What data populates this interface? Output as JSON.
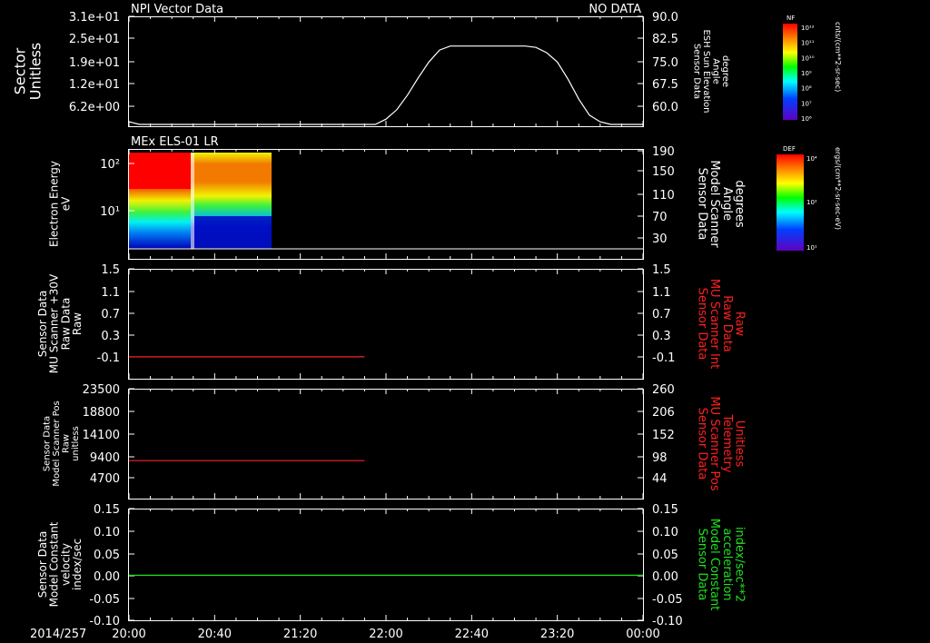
{
  "chart_data": [
    {
      "type": "line",
      "panel_title_left": "NPI Vector Data",
      "panel_title_right": "NO DATA",
      "ylabel_left": [
        "Sector",
        "Unitless"
      ],
      "yticks_left": [
        "3.1e+01",
        "2.5e+01",
        "1.9e+01",
        "1.2e+01",
        "6.2e+00"
      ],
      "ylabel_right": [
        "Sensor Data",
        "ESH Sun Elevation",
        "Angle",
        "degree"
      ],
      "yticks_right": [
        "90.0",
        "82.5",
        "75.0",
        "67.5",
        "60.0"
      ],
      "ylim_right": [
        52.5,
        92.5
      ],
      "series": [
        {
          "color": "#ffffff",
          "x": [
            "20:00",
            "20:05",
            "20:10",
            "20:15",
            "21:50",
            "21:55",
            "22:00",
            "22:05",
            "22:10",
            "22:15",
            "22:20",
            "22:25",
            "22:30",
            "22:35",
            "22:40",
            "22:45",
            "22:50",
            "22:55",
            "23:00",
            "23:05",
            "23:10",
            "23:15",
            "23:20",
            "23:25",
            "23:30",
            "23:35",
            "23:40",
            "23:45",
            "23:50",
            "23:55",
            "24:00"
          ],
          "y": [
            53.5,
            52.5,
            52.5,
            52.5,
            52.5,
            52.5,
            54.5,
            58.0,
            63.5,
            70.0,
            76.0,
            80.5,
            82.0,
            82.0,
            82.0,
            82.0,
            82.0,
            82.0,
            82.0,
            82.0,
            81.5,
            79.5,
            76.0,
            69.5,
            62.0,
            56.0,
            53.5,
            52.5,
            52.5,
            52.5,
            52.5
          ]
        }
      ]
    },
    {
      "type": "heatmap",
      "panel_title": "MEx ELS-01 LR",
      "ylabel_left": [
        "Electron Energy",
        "eV"
      ],
      "yticks_left": [
        "10²",
        "10¹"
      ],
      "ylabel_right": [
        "Sensor Data",
        "Model Scanner",
        "Angle",
        "degrees"
      ],
      "yticks_right": [
        "190",
        "150",
        "110",
        "70",
        "30"
      ],
      "x_range": [
        "20:00",
        "20:59"
      ],
      "colorbar": {
        "label": "DEF",
        "units": "ergs/(cm**2-sr-sec-eV)",
        "ticks": [
          "10⁴",
          "10²",
          "10¹"
        ]
      }
    },
    {
      "type": "line",
      "ylabel_left": [
        "Sensor Data",
        "MU Scanner +30V",
        "Raw Data",
        "Raw"
      ],
      "yticks_left": [
        "1.5",
        "1.1",
        "0.7",
        "0.3",
        "-0.1"
      ],
      "ylabel_right": [
        "Sensor Data",
        "MU Scanner Int",
        "Raw Data",
        "Raw"
      ],
      "yticks_right": [
        "1.5",
        "1.1",
        "0.7",
        "0.3",
        "-0.1"
      ],
      "ylim": [
        -0.35,
        1.5
      ],
      "series": [
        {
          "color": "#ff2020",
          "x": [
            "20:00",
            "21:50"
          ],
          "y": [
            0.0,
            0.0
          ]
        }
      ]
    },
    {
      "type": "line",
      "ylabel_left": [
        "Sensor Data",
        "Model Scanner Pos",
        "Raw",
        "unitless"
      ],
      "yticks_left": [
        "23500",
        "18800",
        "14100",
        "9400",
        "4700"
      ],
      "ylabel_right": [
        "Sensor Data",
        "MU Scanner Pos",
        "Telemetry",
        "Unitless"
      ],
      "yticks_right": [
        "260",
        "206",
        "152",
        "98",
        "44"
      ],
      "ylim": [
        0,
        23500
      ],
      "series": [
        {
          "color": "#ff2020",
          "x": [
            "20:00",
            "21:50"
          ],
          "y": [
            8000,
            8000
          ]
        }
      ]
    },
    {
      "type": "line",
      "ylabel_left": [
        "Sensor Data",
        "Model Constant",
        "velocity",
        "index/sec"
      ],
      "yticks_left": [
        "0.15",
        "0.10",
        "0.05",
        "0.00",
        "-0.05",
        "-0.10"
      ],
      "ylabel_right": [
        "Sensor Data",
        "Model Constant",
        "acceleration",
        "index/sec**2"
      ],
      "yticks_right": [
        "0.15",
        "0.10",
        "0.05",
        "0.00",
        "-0.05",
        "-0.10"
      ],
      "ylim": [
        -0.1,
        0.15
      ],
      "series": [
        {
          "color": "#20e020",
          "x": [
            "20:00",
            "24:00"
          ],
          "y": [
            0.0,
            0.0
          ]
        }
      ]
    }
  ],
  "xaxis": {
    "date_label": "2014/257",
    "ticks": [
      "20:00",
      "20:40",
      "21:20",
      "22:00",
      "22:40",
      "23:20",
      "00:00"
    ]
  },
  "colorbars": [
    {
      "label": "NF",
      "units": "cnts/(cm**2-sr-sec)",
      "ticks": [
        "10¹²",
        "10¹¹",
        "10¹⁰",
        "10⁹",
        "10⁸",
        "10⁷",
        "10⁶"
      ]
    },
    {
      "label": "DEF",
      "units": "ergs/(cm**2-sr-sec-eV)",
      "ticks": [
        "10⁴",
        "10²",
        "10¹"
      ]
    }
  ],
  "colors": {
    "background": "#000000",
    "axes": "#ffffff",
    "right_label_panel3": "#ff2020",
    "right_label_panel4": "#ff2020",
    "right_label_panel5": "#20e020"
  }
}
